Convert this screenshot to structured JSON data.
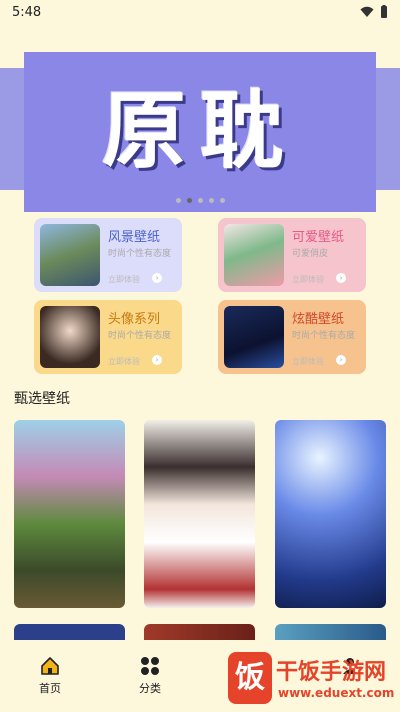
{
  "status_bar": {
    "time": "5:48"
  },
  "banner": {
    "title": "原耽",
    "slide_count": 5,
    "active_slide": 1
  },
  "categories": [
    {
      "title": "风景壁纸",
      "subtitle": "时尚个性有态度",
      "cta": "立即体验",
      "accent": "#4a64c8"
    },
    {
      "title": "可爱壁纸",
      "subtitle": "可爱俏皮",
      "cta": "立即体验",
      "accent": "#e85a8a"
    },
    {
      "title": "头像系列",
      "subtitle": "时尚个性有态度",
      "cta": "立即体验",
      "accent": "#c67a10"
    },
    {
      "title": "炫酷壁纸",
      "subtitle": "时尚个性有态度",
      "cta": "立即体验",
      "accent": "#d04a2a"
    }
  ],
  "section": {
    "title": "甄选壁纸"
  },
  "nav": {
    "items": [
      {
        "label": "首页",
        "icon": "home-icon",
        "active": true
      },
      {
        "label": "分类",
        "icon": "grid-icon"
      },
      {
        "label": "",
        "icon": "square-icon"
      },
      {
        "label": "",
        "icon": "user-icon"
      }
    ]
  },
  "watermark": {
    "logo_char": "饭",
    "text": "干饭手游网",
    "url": "www.eduext.com"
  }
}
